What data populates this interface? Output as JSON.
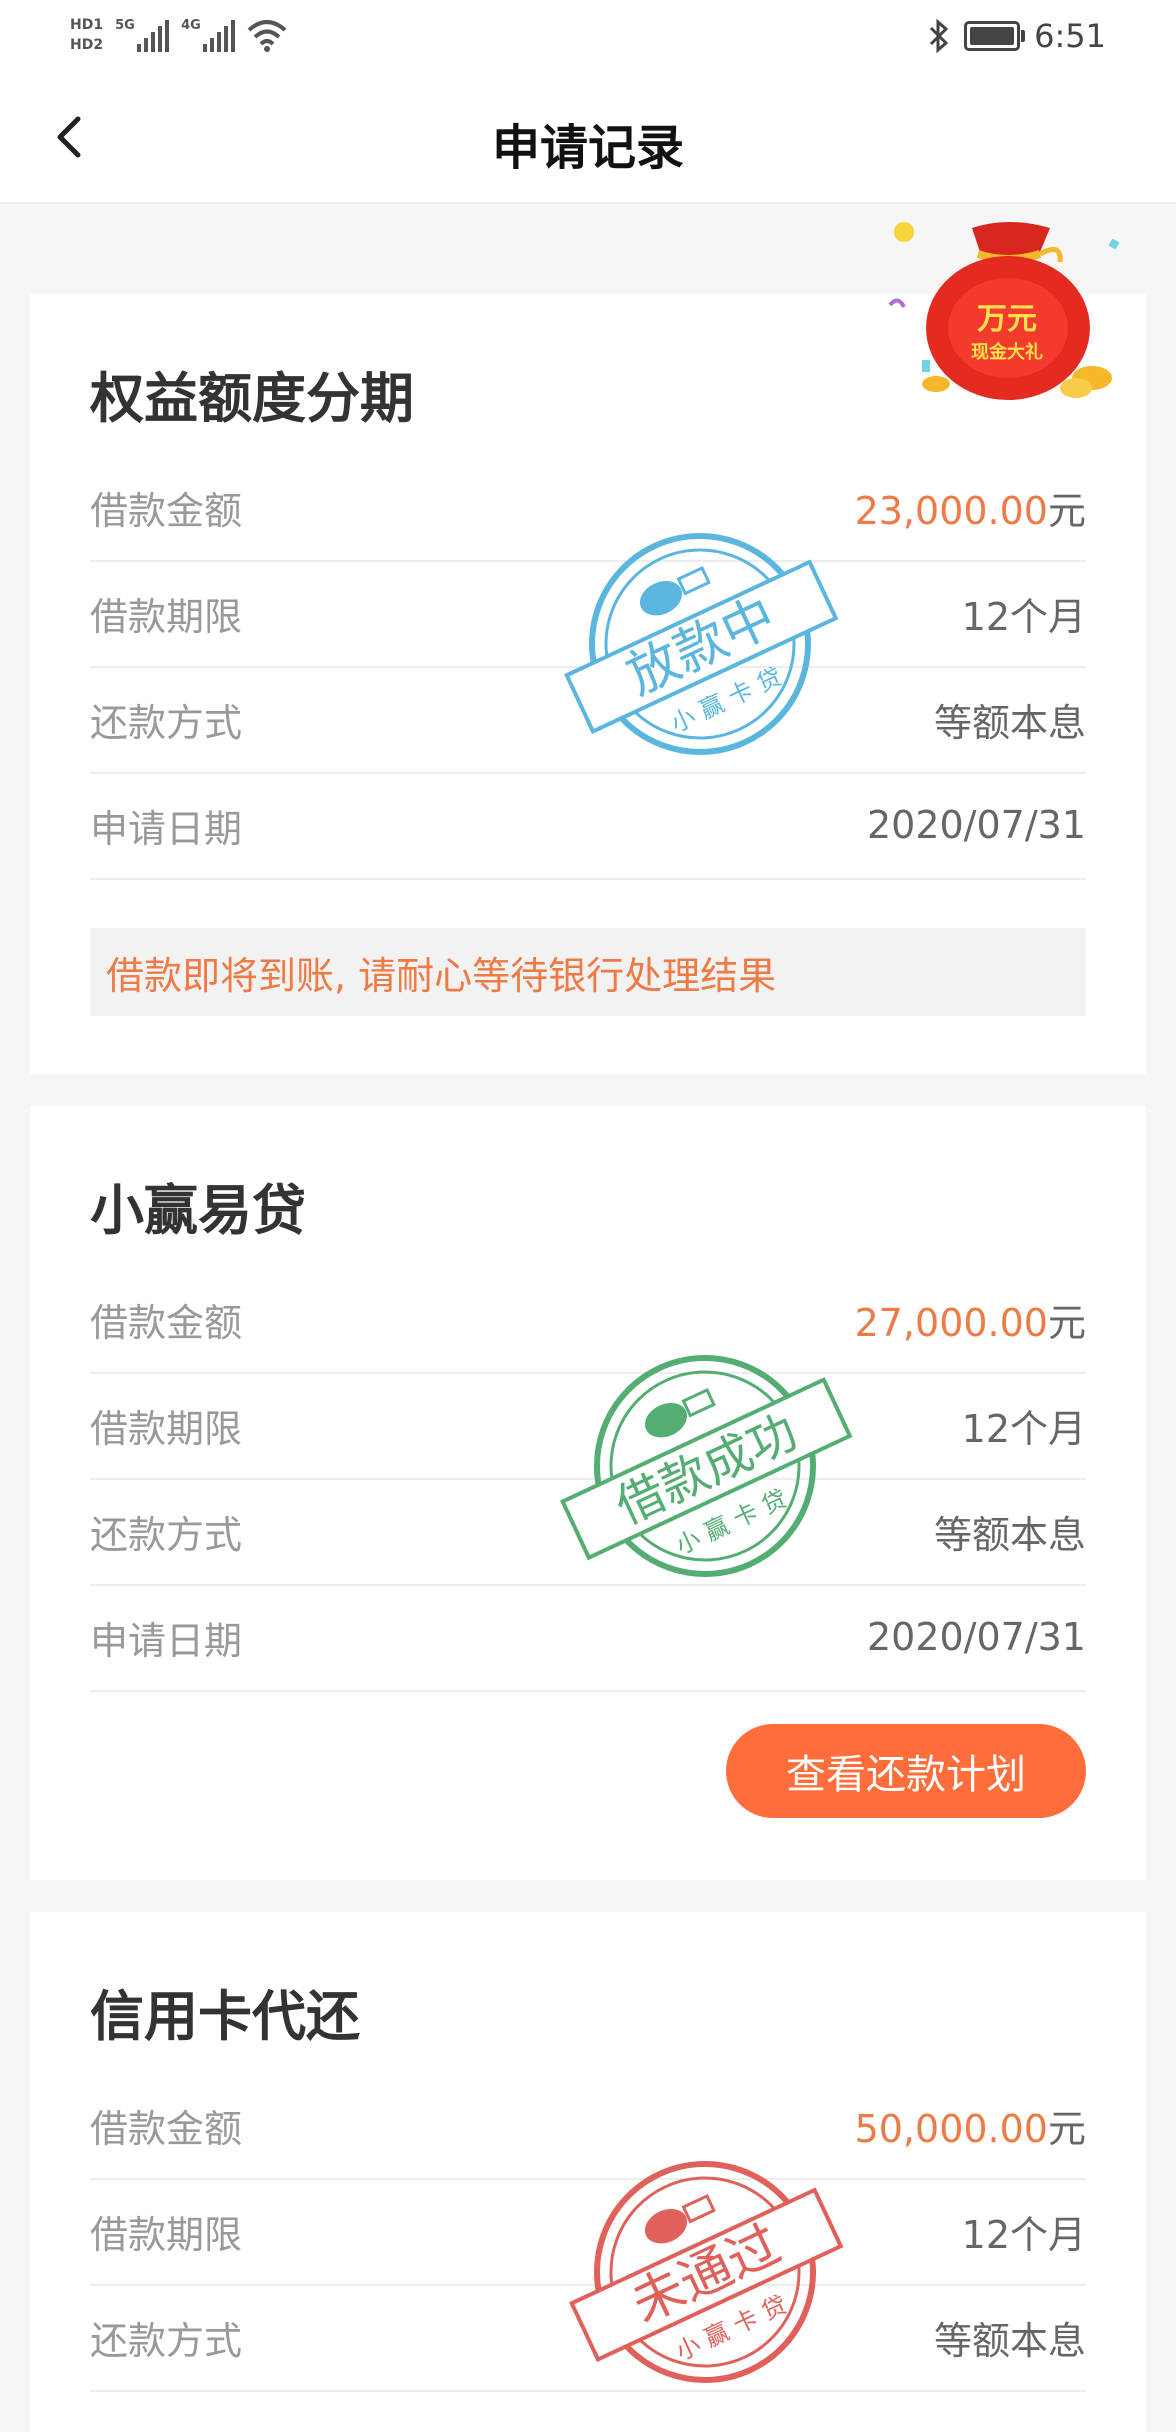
{
  "status_bar": {
    "hd1": "HD1",
    "hd2": "HD2",
    "net1": "5G",
    "net2": "4G",
    "time": "6:51"
  },
  "header": {
    "title": "申请记录"
  },
  "promo": {
    "line1": "万元",
    "line2": "现金大礼"
  },
  "cards": [
    {
      "title": "权益额度分期",
      "rows": {
        "amount_label": "借款金额",
        "amount_value": "23,000.00",
        "amount_unit": "元",
        "term_label": "借款期限",
        "term_value": "12个月",
        "method_label": "还款方式",
        "method_value": "等额本息",
        "date_label": "申请日期",
        "date_value": "2020/07/31"
      },
      "notice": "借款即将到账, 请耐心等待银行处理结果",
      "stamp": {
        "text": "放款中",
        "sub": "小 赢 卡 贷",
        "color": "#5ab6df"
      }
    },
    {
      "title": "小赢易贷",
      "rows": {
        "amount_label": "借款金额",
        "amount_value": "27,000.00",
        "amount_unit": "元",
        "term_label": "借款期限",
        "term_value": "12个月",
        "method_label": "还款方式",
        "method_value": "等额本息",
        "date_label": "申请日期",
        "date_value": "2020/07/31"
      },
      "button": "查看还款计划",
      "stamp": {
        "text": "借款成功",
        "sub": "小 赢 卡 贷",
        "color": "#54ad73"
      }
    },
    {
      "title": "信用卡代还",
      "rows": {
        "amount_label": "借款金额",
        "amount_value": "50,000.00",
        "amount_unit": "元",
        "term_label": "借款期限",
        "term_value": "12个月",
        "method_label": "还款方式",
        "method_value": "等额本息"
      },
      "stamp": {
        "text": "未通过",
        "sub": "小 赢 卡 贷",
        "color": "#e0605a"
      }
    }
  ]
}
